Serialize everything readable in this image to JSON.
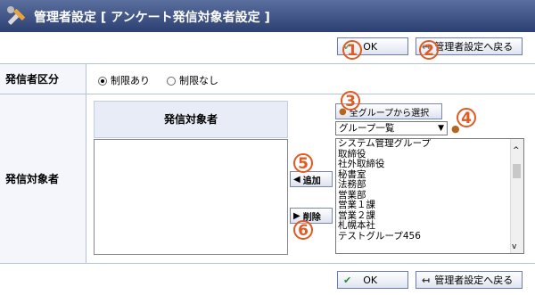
{
  "header": {
    "title": "管理者設定 [ アンケート発信対象者設定 ]"
  },
  "toolbar": {
    "ok_label": "OK",
    "back_label": "管理者設定へ戻る"
  },
  "form": {
    "sender_type_label": "発信者区分",
    "radio_restricted": "制限あり",
    "radio_unrestricted": "制限なし",
    "selected": "制限あり",
    "target_label": "発信対象者",
    "target_list_header": "発信対象者",
    "select_all_groups_label": "全グループから選択",
    "group_dropdown_value": "グループ一覧",
    "add_label": "追加",
    "remove_label": "削除",
    "group_items": [
      "システム管理グループ",
      "取締役",
      "社外取締役",
      "秘書室",
      "法務部",
      "営業部",
      "営業１課",
      "営業２課",
      "札幌本社",
      "テストグループ456"
    ]
  },
  "annotations": [
    "1",
    "2",
    "3",
    "4",
    "5",
    "6"
  ],
  "colors": {
    "header_bg": "#2c3f72",
    "callout": "#e25a22",
    "ok_check": "#2a8a3a"
  }
}
